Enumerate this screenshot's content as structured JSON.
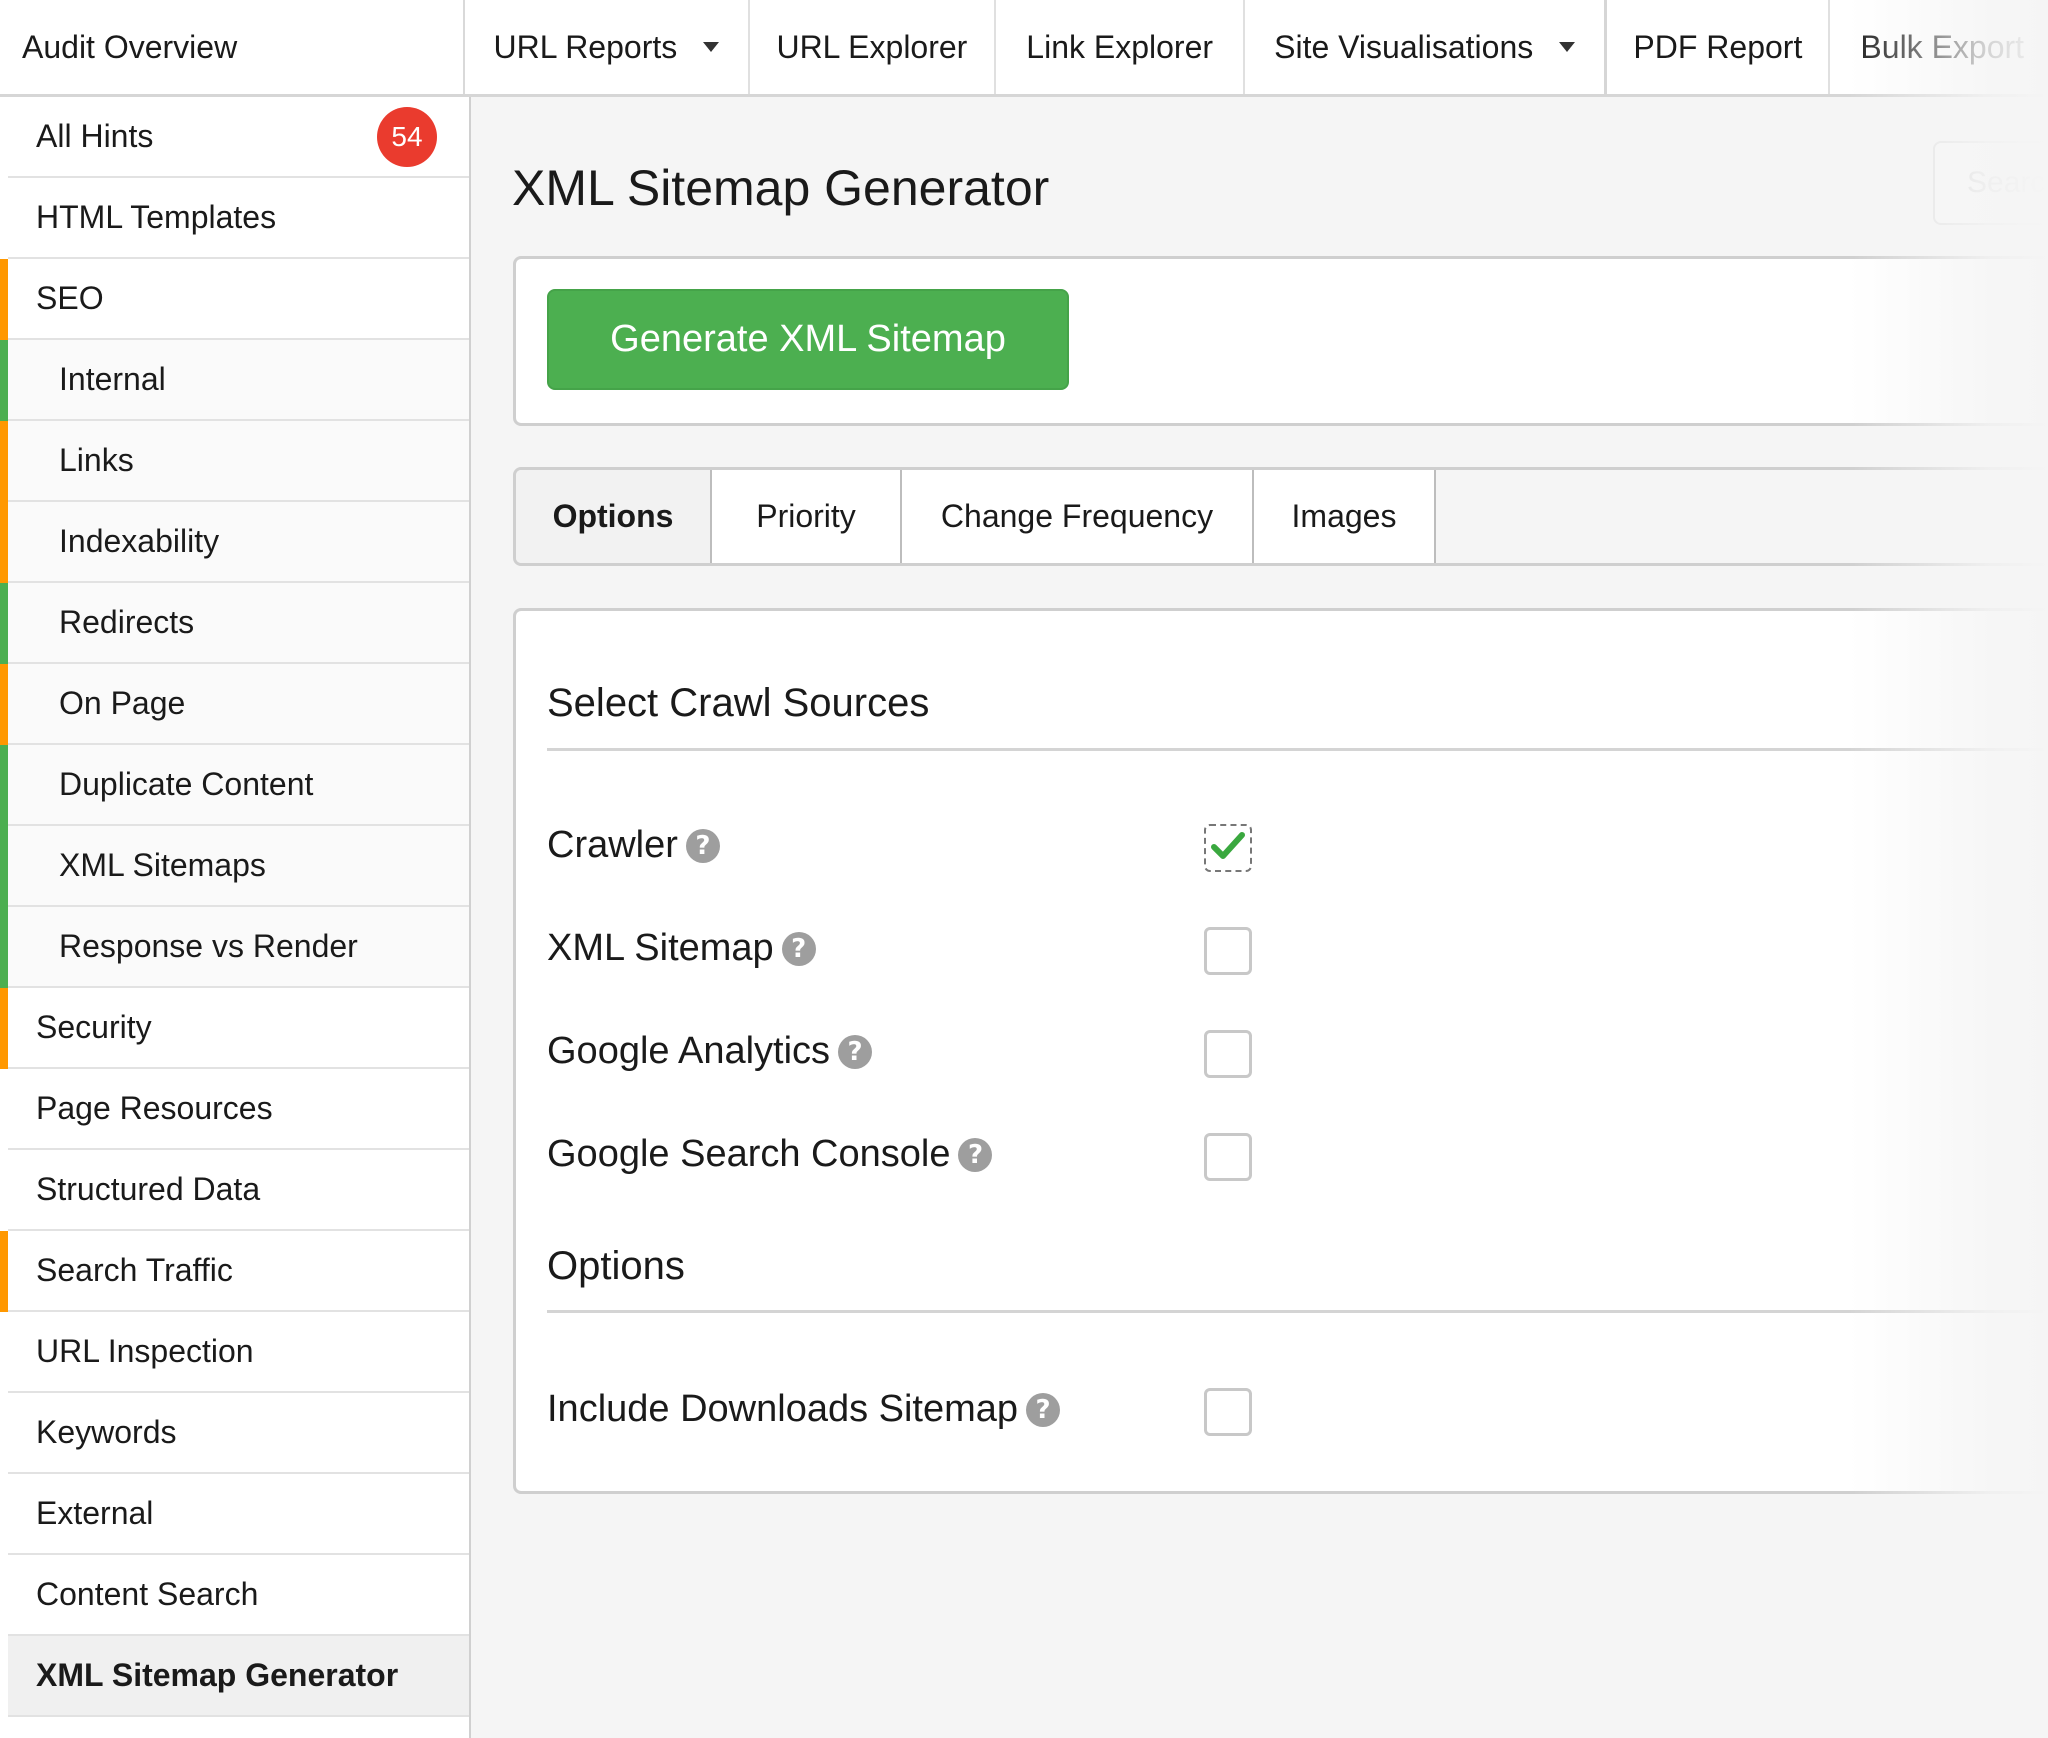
{
  "topbar": {
    "brand": "Audit Overview",
    "items": [
      {
        "label": "URL Reports",
        "dropdown": true
      },
      {
        "label": "URL Explorer",
        "dropdown": false
      },
      {
        "label": "Link Explorer",
        "dropdown": false
      },
      {
        "label": "Site Visualisations",
        "dropdown": true
      },
      {
        "label": "PDF Report",
        "dropdown": false
      },
      {
        "label": "Bulk Export",
        "dropdown": false
      }
    ]
  },
  "sidebar": {
    "items": [
      {
        "label": "All Hints",
        "badge": "54",
        "level": 0,
        "status": "none"
      },
      {
        "label": "HTML Templates",
        "level": 0,
        "status": "none"
      },
      {
        "label": "SEO",
        "level": 0,
        "status": "warning"
      },
      {
        "label": "Internal",
        "level": 1,
        "status": "ok"
      },
      {
        "label": "Links",
        "level": 1,
        "status": "warning"
      },
      {
        "label": "Indexability",
        "level": 1,
        "status": "warning"
      },
      {
        "label": "Redirects",
        "level": 1,
        "status": "ok"
      },
      {
        "label": "On Page",
        "level": 1,
        "status": "warning"
      },
      {
        "label": "Duplicate Content",
        "level": 1,
        "status": "ok"
      },
      {
        "label": "XML Sitemaps",
        "level": 1,
        "status": "ok"
      },
      {
        "label": "Response vs Render",
        "level": 1,
        "status": "ok"
      },
      {
        "label": "Security",
        "level": 0,
        "status": "warning"
      },
      {
        "label": "Page Resources",
        "level": 0,
        "status": "none"
      },
      {
        "label": "Structured Data",
        "level": 0,
        "status": "none"
      },
      {
        "label": "Search Traffic",
        "level": 0,
        "status": "warning"
      },
      {
        "label": "URL Inspection",
        "level": 0,
        "status": "none"
      },
      {
        "label": "Keywords",
        "level": 0,
        "status": "none"
      },
      {
        "label": "External",
        "level": 0,
        "status": "none"
      },
      {
        "label": "Content Search",
        "level": 0,
        "status": "none"
      },
      {
        "label": "XML Sitemap Generator",
        "level": 0,
        "status": "none",
        "active": true
      }
    ],
    "status_colors": {
      "warning": "#ff9800",
      "ok": "#4caf50",
      "none": "transparent"
    }
  },
  "main": {
    "title": "XML Sitemap Generator",
    "search_placeholder": "Search",
    "generate_button": "Generate XML Sitemap",
    "tabs": [
      {
        "label": "Options",
        "active": true
      },
      {
        "label": "Priority",
        "active": false
      },
      {
        "label": "Change Frequency",
        "active": false
      },
      {
        "label": "Images",
        "active": false
      }
    ],
    "crawl_sources": {
      "title": "Select Crawl Sources",
      "items": [
        {
          "label": "Crawler",
          "checked": true
        },
        {
          "label": "XML Sitemap",
          "checked": false
        },
        {
          "label": "Google Analytics",
          "checked": false
        },
        {
          "label": "Google Search Console",
          "checked": false
        }
      ]
    },
    "options": {
      "title": "Options",
      "items": [
        {
          "label": "Include Downloads Sitemap",
          "checked": false
        }
      ]
    },
    "help_glyph": "?",
    "colors": {
      "accent_green": "#4caf50",
      "badge_red": "#ea3b2e",
      "check_green": "#3aa83f"
    }
  }
}
